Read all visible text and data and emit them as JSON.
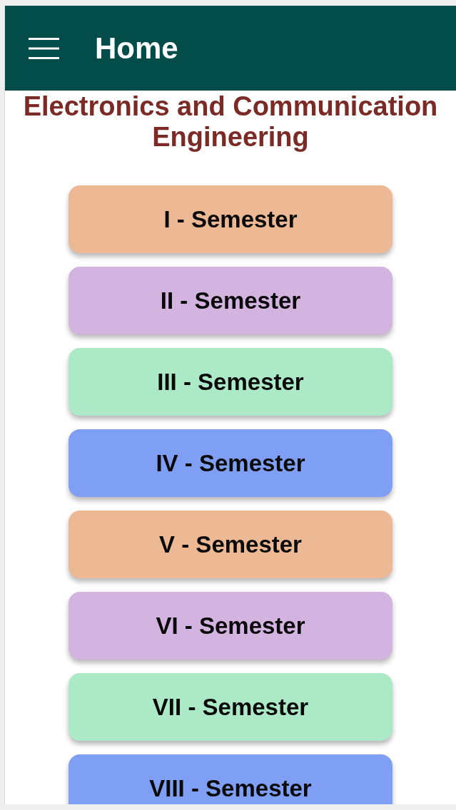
{
  "app_bar": {
    "title": "Home"
  },
  "heading": "Electronics and Communication Engineering",
  "semesters": [
    {
      "label": "I - Semester",
      "color": "#edb994"
    },
    {
      "label": "II - Semester",
      "color": "#d3b4e1"
    },
    {
      "label": "III - Semester",
      "color": "#abe9c7"
    },
    {
      "label": "IV - Semester",
      "color": "#7f9ff4"
    },
    {
      "label": "V - Semester",
      "color": "#edb994"
    },
    {
      "label": "VI - Semester",
      "color": "#d3b4e1"
    },
    {
      "label": "VII - Semester",
      "color": "#abe9c7"
    },
    {
      "label": "VIII - Semester",
      "color": "#7f9ff4"
    }
  ]
}
